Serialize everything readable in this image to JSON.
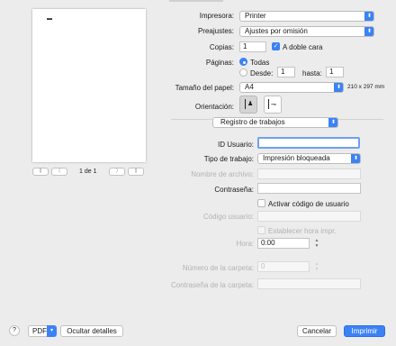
{
  "preview": {
    "page_mark": "▬",
    "page_label": "1 de 1",
    "first": "⟪",
    "prev": "⟨",
    "next": "⟩",
    "last": "⟫"
  },
  "printer": {
    "label": "Impresora:",
    "value": "Printer"
  },
  "presets": {
    "label": "Preajustes:",
    "value": "Ajustes por omisión"
  },
  "copies": {
    "label": "Copias:",
    "value": "1",
    "duplex_label": "A doble cara"
  },
  "pages": {
    "label": "Páginas:",
    "all_label": "Todas",
    "from_label": "Desde:",
    "from_value": "1",
    "to_label": "hasta:",
    "to_value": "1"
  },
  "paper": {
    "label": "Tamaño del papel:",
    "value": "A4",
    "dims": "210 x 297 mm"
  },
  "orientation": {
    "label": "Orientación:"
  },
  "section": {
    "value": "Registro de trabajos"
  },
  "form": {
    "user_id_label": "ID Usuario:",
    "user_id_value": "",
    "job_type_label": "Tipo de trabajo:",
    "job_type_value": "Impresión bloqueada",
    "filename_label": "Nombre de archivo:",
    "password_label": "Contraseña:",
    "user_code_toggle_label": "Activar código de usuario",
    "user_code_label": "Código usuario:",
    "set_time_label": "Establecer hora impr.",
    "time_label": "Hora:",
    "time_value": "0:00",
    "folder_number_label": "Número de la carpeta:",
    "folder_number_value": "0",
    "folder_password_label": "Contraseña de la carpeta:"
  },
  "footer": {
    "help": "?",
    "pdf": "PDF",
    "hide_details": "Ocultar detalles",
    "cancel": "Cancelar",
    "print": "Imprimir"
  },
  "colors": {
    "accent": "#3b82f5"
  }
}
